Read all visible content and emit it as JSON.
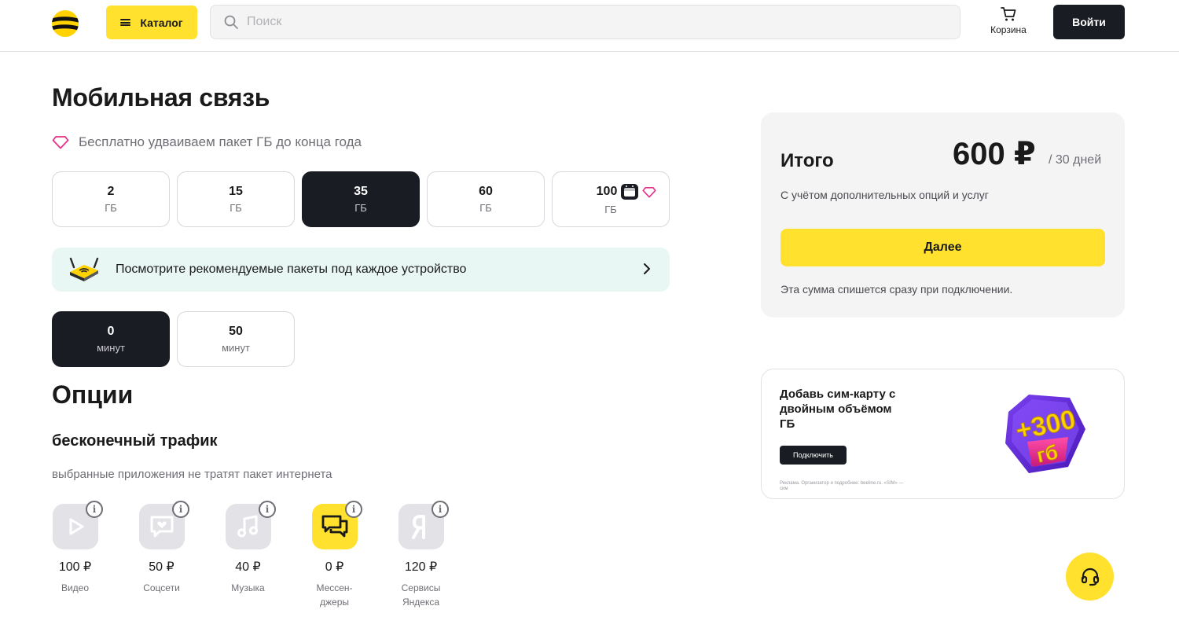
{
  "header": {
    "catalog_label": "Каталог",
    "search_placeholder": "Поиск",
    "cart_label": "Корзина",
    "login_label": "Войти"
  },
  "page": {
    "title": "Мобильная связь",
    "promo_text": "Бесплатно удваиваем пакет ГБ до конца года"
  },
  "data_packages": [
    {
      "value": "2",
      "unit": "ГБ",
      "selected": false
    },
    {
      "value": "15",
      "unit": "ГБ",
      "selected": false
    },
    {
      "value": "35",
      "unit": "ГБ",
      "selected": true
    },
    {
      "value": "60",
      "unit": "ГБ",
      "selected": false
    },
    {
      "value": "100",
      "unit": "ГБ",
      "selected": false
    }
  ],
  "device_banner": {
    "text": "Посмотрите рекомендуемые пакеты под каждое устройство"
  },
  "minute_packages": [
    {
      "value": "0",
      "unit": "минут",
      "selected": true
    },
    {
      "value": "50",
      "unit": "минут",
      "selected": false
    }
  ],
  "options": {
    "title": "Опции",
    "traffic_title": "бесконечный трафик",
    "traffic_subtitle": "выбранные приложения не тратят пакет интернета",
    "apps": [
      {
        "icon": "video-play-icon",
        "price": "100 ₽",
        "name": "Видео",
        "selected": false
      },
      {
        "icon": "social-heart-icon",
        "price": "50 ₽",
        "name": "Соцсети",
        "selected": false
      },
      {
        "icon": "music-note-icon",
        "price": "40 ₽",
        "name": "Музыка",
        "selected": false
      },
      {
        "icon": "messenger-chat-icon",
        "price": "0 ₽",
        "name_line1": "Мессен-",
        "name_line2": "джеры",
        "selected": true
      },
      {
        "icon": "yandex-icon",
        "price": "120 ₽",
        "name_line1": "Сервисы",
        "name_line2": "Яндекса",
        "selected": false
      }
    ]
  },
  "summary": {
    "label": "Итого",
    "price": "600 ₽",
    "period": "/ 30 дней",
    "note": "С учётом дополнительных опций и услуг",
    "next_label": "Далее",
    "footnote": "Эта сумма спишется сразу при подключении."
  },
  "ad": {
    "title": "Добавь сим-карту с двойным объёмом ГБ",
    "button_label": "Подключить",
    "legal": "Реклама. Организатор и подробнее: beeline.ru. «SIM» — сим",
    "badge_top": "+300",
    "badge_bottom": "гб"
  },
  "colors": {
    "brand_yellow": "#ffe12e",
    "dark": "#191c22",
    "surface": "#f4f4f5",
    "accent_pink": "#e5338a",
    "banner_teal": "#e8f6f4"
  }
}
